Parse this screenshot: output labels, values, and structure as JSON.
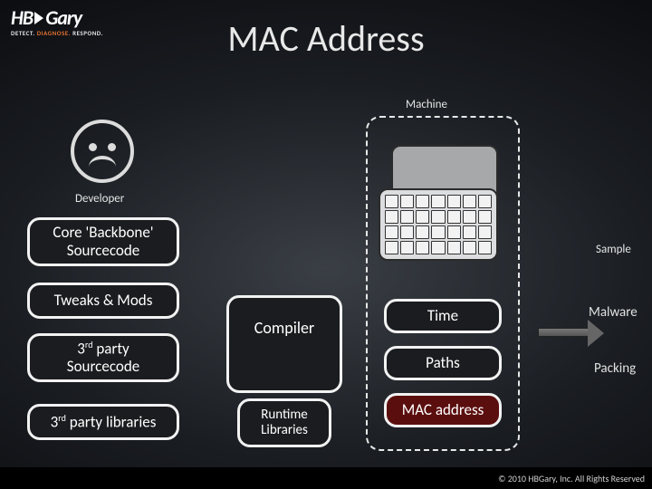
{
  "logo": {
    "left": "HB",
    "right": "Gary",
    "tagline_detect": "DETECT.",
    "tagline_diagnose": "DIAGNOSE.",
    "tagline_respond": "RESPOND."
  },
  "title": "MAC Address",
  "labels": {
    "machine": "Machine",
    "developer": "Developer",
    "sample": "Sample",
    "malware": "Malware",
    "packing": "Packing"
  },
  "left_column": {
    "core": "Core 'Backbone' Sourcecode",
    "tweaks": "Tweaks & Mods",
    "third_src": "3rd party Sourcecode",
    "third_src_sup": "rd",
    "third_src_pre": "3",
    "third_src_post": " party",
    "third_src_line2": "Sourcecode",
    "third_lib_pre": "3",
    "third_lib_sup": "rd",
    "third_lib_post": " party libraries"
  },
  "center": {
    "compiler": "Compiler",
    "runtime": "Runtime Libraries"
  },
  "machine_items": {
    "time": "Time",
    "paths": "Paths",
    "mac": "MAC address"
  },
  "footer": "© 2010 HBGary, Inc. All Rights Reserved"
}
